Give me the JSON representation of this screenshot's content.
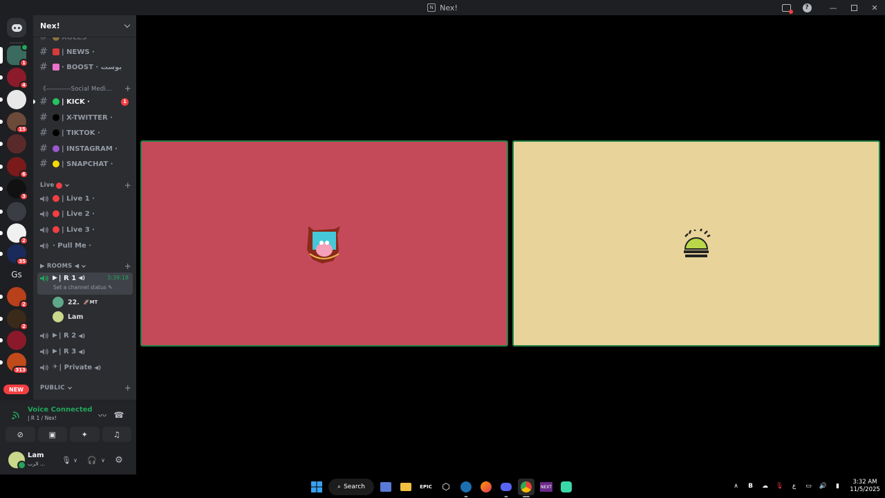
{
  "window": {
    "title": "Nex!"
  },
  "rail": {
    "servers": [
      {
        "name": "server-1",
        "badge": "1",
        "color": "#3a6b5e",
        "active": true
      },
      {
        "name": "server-2",
        "badge": "4",
        "color": "#8b1a2a"
      },
      {
        "name": "server-3",
        "badge": "",
        "color": "#e8e8e8"
      },
      {
        "name": "server-4",
        "badge": "15",
        "color": "#6b4a3a"
      },
      {
        "name": "server-5",
        "badge": "",
        "color": "#5a2a2a"
      },
      {
        "name": "server-6",
        "badge": "6",
        "color": "#7a1a1a"
      },
      {
        "name": "server-7",
        "badge": "3",
        "color": "#111111"
      },
      {
        "name": "server-8",
        "badge": "",
        "color": "#3a3d44"
      },
      {
        "name": "server-9",
        "badge": "2",
        "color": "#f0f0f0"
      },
      {
        "name": "server-10",
        "badge": "35",
        "color": "#1a2a5a"
      },
      {
        "name": "server-12",
        "badge": "2",
        "color": "#b8401a"
      },
      {
        "name": "server-13",
        "badge": "2",
        "color": "#3a2a1a"
      },
      {
        "name": "server-14",
        "badge": "",
        "color": "#8a1a2a"
      },
      {
        "name": "server-15",
        "badge": "313",
        "color": "#c04a1a"
      }
    ],
    "text_server": "Gs",
    "new_label": "NEW"
  },
  "guild": {
    "name": "Nex!"
  },
  "channels": {
    "partial_top": "ROLES",
    "news": "| NEWS ·",
    "boost": "· BOOST · بوست",
    "social_cat": "《-----------Social Medi...",
    "kick": "| KICK ·",
    "kick_mentions": "1",
    "x_twitter": "| X-TWITTER ·",
    "tiktok": "| TIKTOK ·",
    "instagram": "| INSTAGRAM ·",
    "snapchat": "| SNAPCHAT ·",
    "live_cat": "Live",
    "live1": "| Live 1 ·",
    "live2": "| Live 2 ·",
    "live3": "| Live 3 ·",
    "pullme": "· Pull Me ·",
    "rooms_cat": "▶ ROOMS ◀",
    "r1": "| R 1",
    "r1_timer": "3:39:18",
    "r1_status": "Set a channel status",
    "member1_name": "22.",
    "member1_tag": "MT",
    "member2_name": "Lam",
    "r2": "| R 2",
    "r3": "| R 3",
    "private": "| Private",
    "public_cat": "PUBLIC"
  },
  "voice": {
    "title": "Voice Connected",
    "sub": "| R 1  / Nex!"
  },
  "user": {
    "name": "Lam",
    "status": "الرب ..."
  },
  "taskbar": {
    "search_label": "Search",
    "apps": [
      "widgets",
      "explorer",
      "epic",
      "unity",
      "steam",
      "firefox",
      "discord",
      "chrome",
      "next",
      "app-green"
    ],
    "time": "3:32 AM",
    "date": "11/5/2025",
    "lang": "ع"
  }
}
